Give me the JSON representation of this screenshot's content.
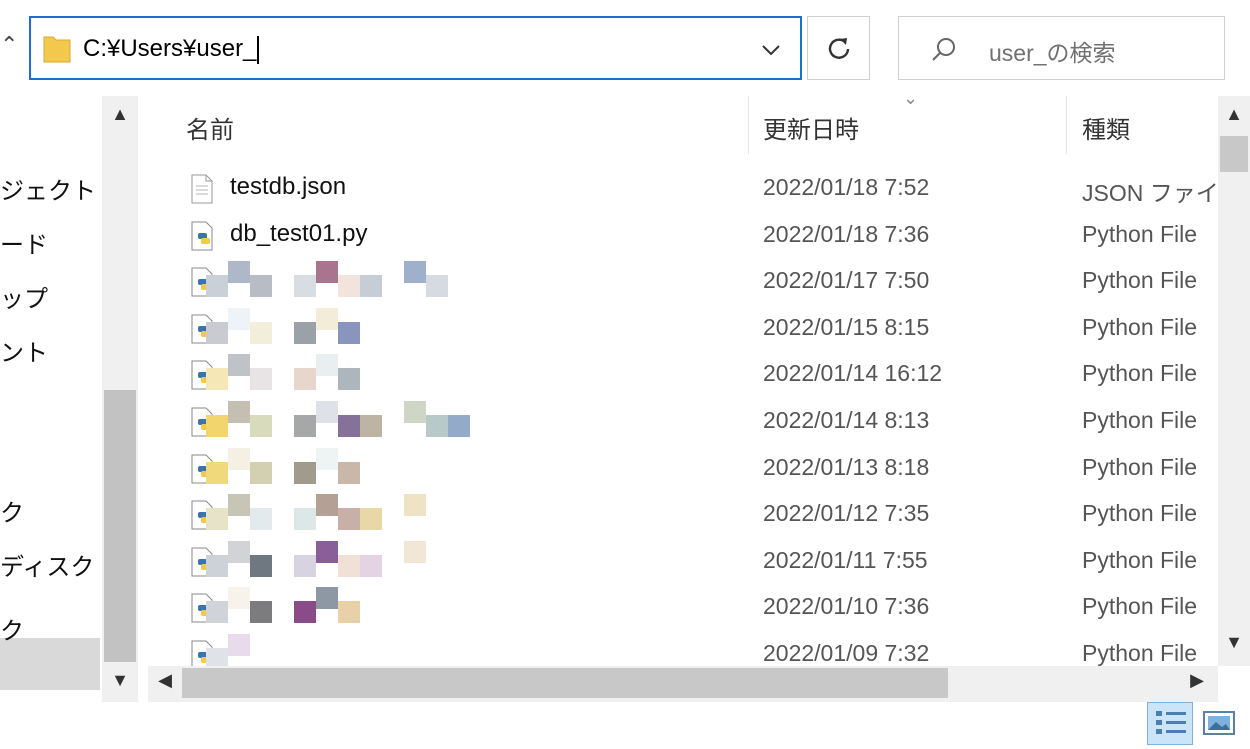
{
  "address": {
    "path": "C:¥Users¥user_"
  },
  "search": {
    "placeholder": "user_の検索"
  },
  "nav": {
    "items": [
      {
        "label": "ジェクト"
      },
      {
        "label": "ード"
      },
      {
        "label": "ップ"
      },
      {
        "label": "ント"
      },
      {
        "label": "ク"
      },
      {
        "label": "ディスク (C"
      },
      {
        "label": "ク"
      }
    ]
  },
  "columns": {
    "name": "名前",
    "modified": "更新日時",
    "type": "種類"
  },
  "files": [
    {
      "name": "testdb.json",
      "modified": "2022/01/18 7:52",
      "type": "JSON ファイル",
      "icon": "json-file-icon"
    },
    {
      "name": "db_test01.py",
      "modified": "2022/01/18 7:36",
      "type": "Python File",
      "icon": "python-file-icon"
    },
    {
      "name": "",
      "modified": "2022/01/17 7:50",
      "type": "Python File",
      "icon": "python-file-icon"
    },
    {
      "name": "",
      "modified": "2022/01/15 8:15",
      "type": "Python File",
      "icon": "python-file-icon"
    },
    {
      "name": "",
      "modified": "2022/01/14 16:12",
      "type": "Python File",
      "icon": "python-file-icon"
    },
    {
      "name": "",
      "modified": "2022/01/14 8:13",
      "type": "Python File",
      "icon": "python-file-icon"
    },
    {
      "name": "",
      "modified": "2022/01/13 8:18",
      "type": "Python File",
      "icon": "python-file-icon"
    },
    {
      "name": "",
      "modified": "2022/01/12 7:35",
      "type": "Python File",
      "icon": "python-file-icon"
    },
    {
      "name": "",
      "modified": "2022/01/11 7:55",
      "type": "Python File",
      "icon": "python-file-icon"
    },
    {
      "name": "",
      "modified": "2022/01/10 7:36",
      "type": "Python File",
      "icon": "python-file-icon"
    },
    {
      "name": "",
      "modified": "2022/01/09 7:32",
      "type": "Python File",
      "icon": "python-file-icon"
    }
  ],
  "colors": {
    "accent": "#1e6fd0",
    "selection": "#cce4f7",
    "scrollbar": "#c8c8c8"
  }
}
